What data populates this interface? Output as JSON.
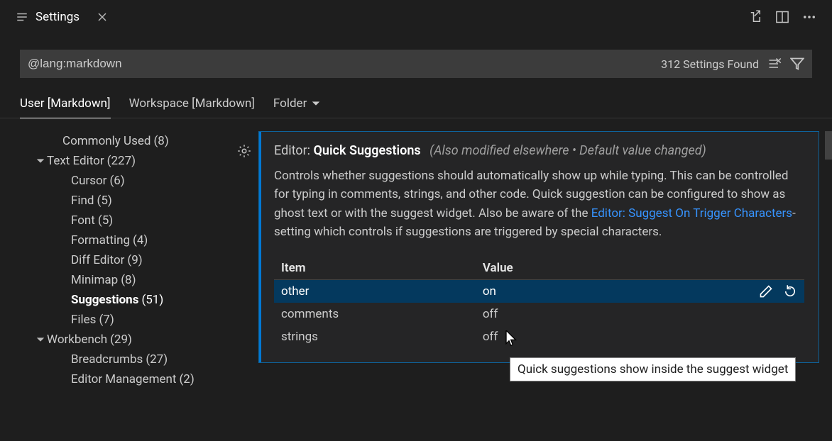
{
  "tab": {
    "title": "Settings"
  },
  "search": {
    "value": "@lang:markdown",
    "found_text": "312 Settings Found"
  },
  "scope": {
    "user": "User [Markdown]",
    "workspace": "Workspace [Markdown]",
    "folder": "Folder"
  },
  "sidebar": {
    "items": [
      {
        "label": "Commonly Used",
        "count": "(8)",
        "indent": 0,
        "chev": "",
        "bold": false
      },
      {
        "label": "Text Editor",
        "count": "(227)",
        "indent": 1,
        "chev": "down",
        "bold": false
      },
      {
        "label": "Cursor",
        "count": "(6)",
        "indent": 2,
        "chev": "",
        "bold": false
      },
      {
        "label": "Find",
        "count": "(5)",
        "indent": 2,
        "chev": "",
        "bold": false
      },
      {
        "label": "Font",
        "count": "(5)",
        "indent": 2,
        "chev": "",
        "bold": false
      },
      {
        "label": "Formatting",
        "count": "(4)",
        "indent": 2,
        "chev": "",
        "bold": false
      },
      {
        "label": "Diff Editor",
        "count": "(9)",
        "indent": 2,
        "chev": "",
        "bold": false
      },
      {
        "label": "Minimap",
        "count": "(8)",
        "indent": 2,
        "chev": "",
        "bold": false
      },
      {
        "label": "Suggestions",
        "count": "(51)",
        "indent": 2,
        "chev": "",
        "bold": true
      },
      {
        "label": "Files",
        "count": "(7)",
        "indent": 2,
        "chev": "",
        "bold": false
      },
      {
        "label": "Workbench",
        "count": "(29)",
        "indent": 1,
        "chev": "down",
        "bold": false
      },
      {
        "label": "Breadcrumbs",
        "count": "(27)",
        "indent": 2,
        "chev": "",
        "bold": false
      },
      {
        "label": "Editor Management",
        "count": "(2)",
        "indent": 2,
        "chev": "",
        "bold": false
      }
    ]
  },
  "setting": {
    "prefix": "Editor: ",
    "name": "Quick Suggestions",
    "meta": "(Also modified elsewhere • Default value changed)",
    "desc_before_link": "Controls whether suggestions should automatically show up while typing. This can be controlled for typing in comments, strings, and other code. Quick suggestion can be configured to show as ghost text or with the suggest widget. Also be aware of the ",
    "link_text": "Editor: Suggest On Trigger Characters",
    "desc_after_link": "-setting which controls if suggestions are triggered by special characters.",
    "columns": {
      "item": "Item",
      "value": "Value"
    },
    "rows": [
      {
        "item": "other",
        "value": "on",
        "selected": true
      },
      {
        "item": "comments",
        "value": "off",
        "selected": false
      },
      {
        "item": "strings",
        "value": "off",
        "selected": false
      }
    ]
  },
  "tooltip": "Quick suggestions show inside the suggest widget"
}
